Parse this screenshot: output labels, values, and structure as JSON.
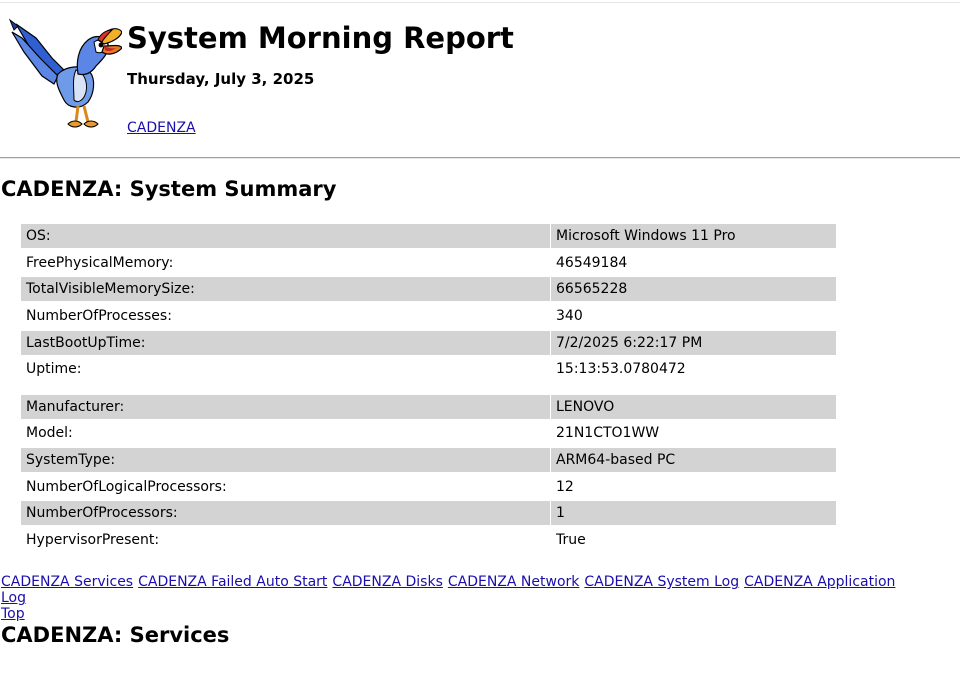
{
  "report": {
    "title": "System Morning Report",
    "date": "Thursday, July 3, 2025",
    "host_link": "CADENZA"
  },
  "summary": {
    "heading": "CADENZA: System Summary",
    "group1": [
      {
        "label": "OS:",
        "value": "Microsoft Windows 11 Pro"
      },
      {
        "label": "FreePhysicalMemory:",
        "value": "46549184"
      },
      {
        "label": "TotalVisibleMemorySize:",
        "value": "66565228"
      },
      {
        "label": "NumberOfProcesses:",
        "value": "340"
      },
      {
        "label": "LastBootUpTime:",
        "value": "7/2/2025 6:22:17 PM"
      },
      {
        "label": "Uptime:",
        "value": "15:13:53.0780472"
      }
    ],
    "group2": [
      {
        "label": "Manufacturer:",
        "value": "LENOVO"
      },
      {
        "label": "Model:",
        "value": "21N1CTO1WW"
      },
      {
        "label": "SystemType:",
        "value": "ARM64-based PC"
      },
      {
        "label": "NumberOfLogicalProcessors:",
        "value": "12"
      },
      {
        "label": "NumberOfProcessors:",
        "value": "1"
      },
      {
        "label": "HypervisorPresent:",
        "value": "True"
      }
    ]
  },
  "nav": {
    "links": [
      "CADENZA Services",
      "CADENZA Failed Auto Start",
      "CADENZA Disks",
      "CADENZA Network",
      "CADENZA System Log",
      "CADENZA Application Log"
    ],
    "top": "Top"
  },
  "services": {
    "heading": "CADENZA: Services"
  },
  "colors": {
    "row_shade": "#d3d3d3",
    "link": "#1a0dab",
    "rule": "#a0a0a0"
  },
  "icons": {
    "logo": "cartoon-hornbill-bird-logo"
  }
}
